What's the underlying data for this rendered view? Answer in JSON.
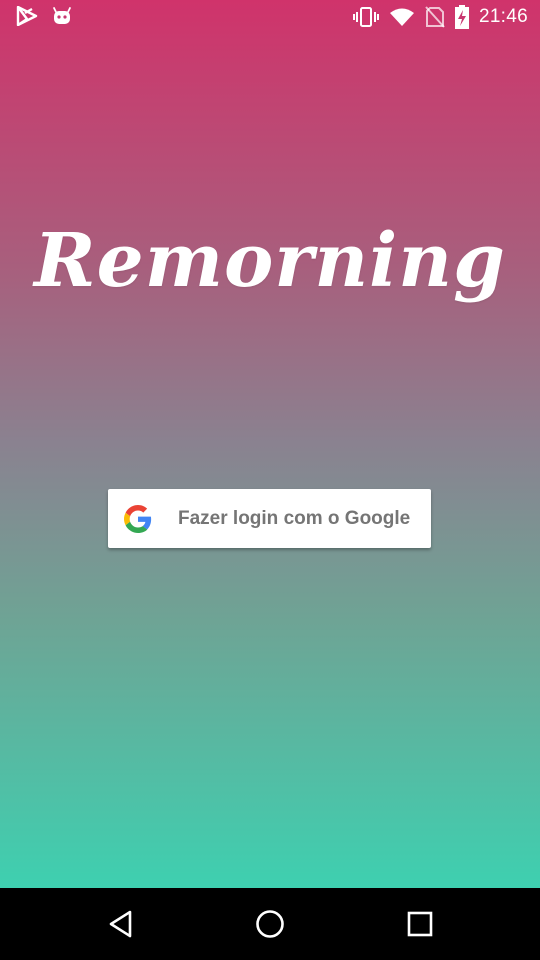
{
  "status_bar": {
    "time": "21:46",
    "left_icons": [
      "play-store-icon",
      "android-icon"
    ],
    "right_icons": [
      "vibrate-icon",
      "wifi-icon",
      "no-sim-icon",
      "battery-charging-icon"
    ]
  },
  "app": {
    "title": "Remorning",
    "gradient_top": "#d0336b",
    "gradient_bottom": "#3ed0b0"
  },
  "login": {
    "button_label": "Fazer login com o Google",
    "icon": "google-logo-icon"
  },
  "nav_bar": {
    "buttons": [
      "back-icon",
      "home-icon",
      "recents-icon"
    ]
  }
}
